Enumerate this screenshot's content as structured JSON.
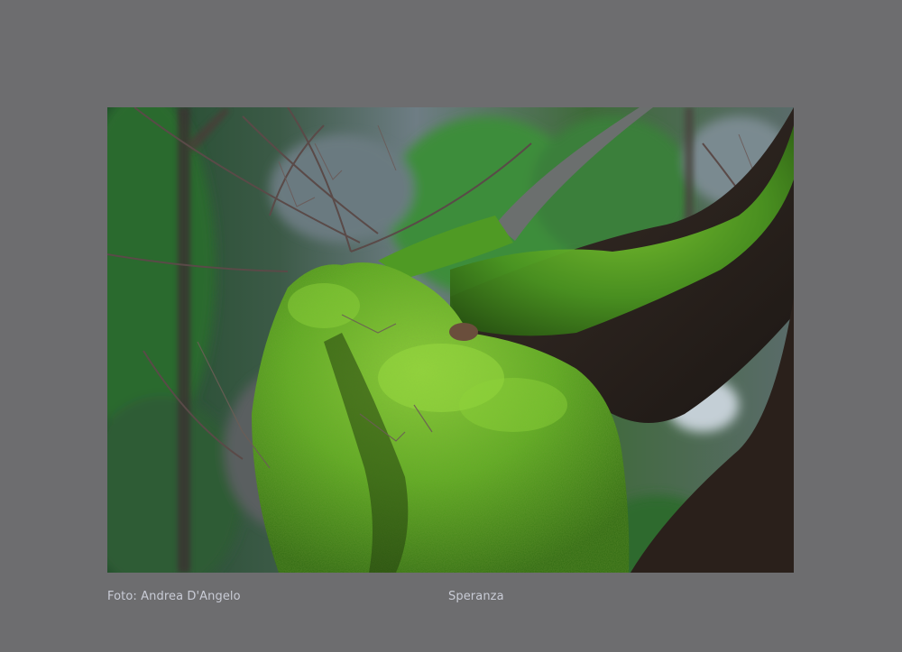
{
  "photo": {
    "subject": "moss-covered-tree-branch"
  },
  "captions": {
    "credit": "Foto: Andrea D'Angelo",
    "title": "Speranza"
  },
  "colors": {
    "page_background": "#6d6d6f",
    "caption_text": "#c9ccd6",
    "moss_green": "#6fb82a",
    "bark_dark": "#2a201b"
  }
}
